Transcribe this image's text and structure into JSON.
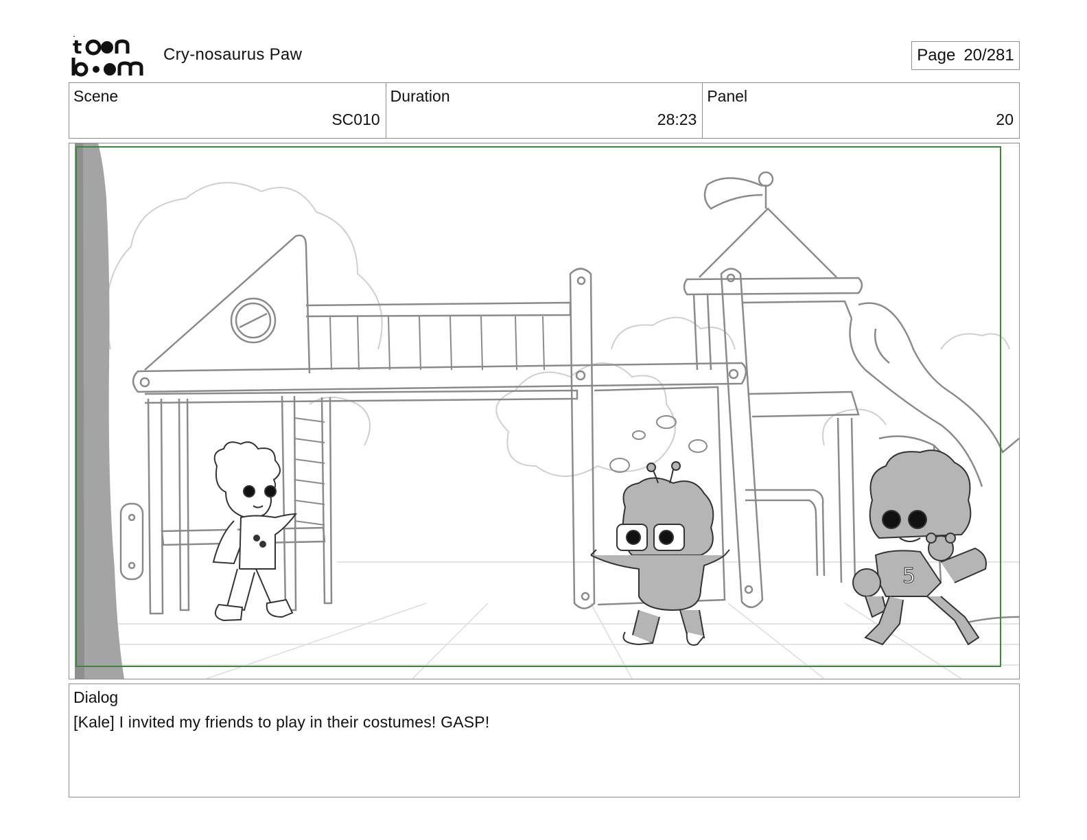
{
  "header": {
    "project_title": "Cry-nosaurus Paw",
    "page_label": "Page",
    "page_number": "20/281"
  },
  "info": {
    "scene_label": "Scene",
    "scene_value": "SC010",
    "duration_label": "Duration",
    "duration_value": "28:23",
    "panel_label": "Panel",
    "panel_value": "20"
  },
  "dialog": {
    "label": "Dialog",
    "text": "[Kale] I invited my friends to play in their costumes! GASP!"
  },
  "colors": {
    "safe_frame": "#3a8a3a",
    "border": "#8c8c8c",
    "sketch_line": "#8a8a8a",
    "character_fill": "#b5b5b5"
  },
  "icons": {
    "logo": "toonboom-logo"
  }
}
